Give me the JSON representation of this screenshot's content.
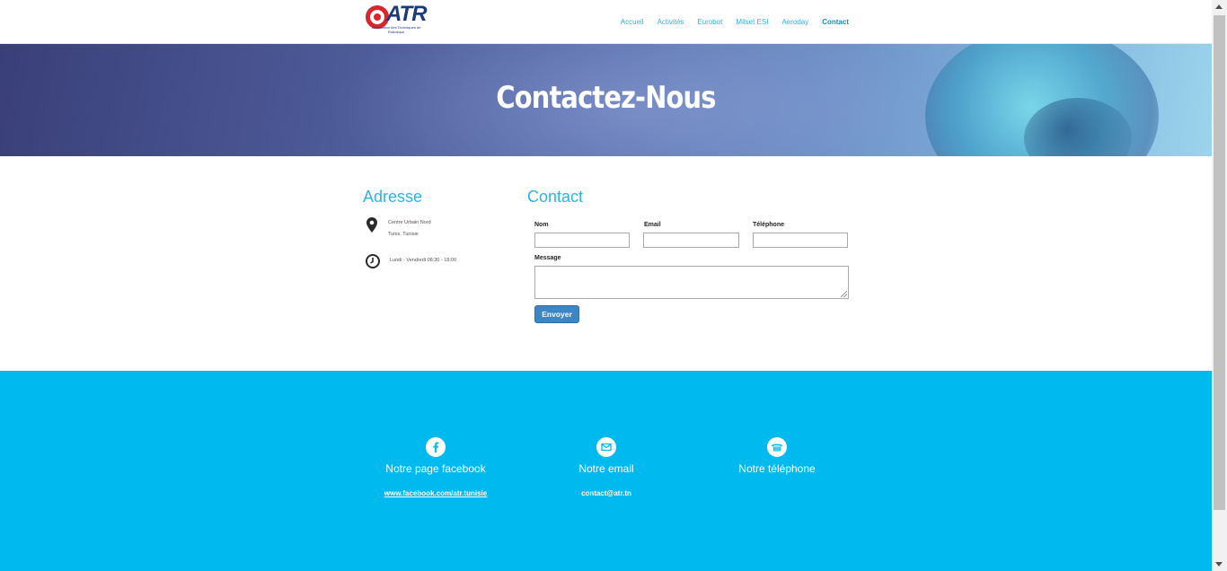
{
  "header": {
    "logo_text": "ATR",
    "logo_tagline": "Association des Techniques de Robotique",
    "nav": [
      {
        "label": "Accueil",
        "active": false
      },
      {
        "label": "Activités",
        "active": false
      },
      {
        "label": "Eurobot",
        "active": false
      },
      {
        "label": "Milset ESI",
        "active": false
      },
      {
        "label": "Aeroday",
        "active": false
      },
      {
        "label": "Contact",
        "active": true
      }
    ]
  },
  "banner": {
    "title": "Contactez-Nous"
  },
  "address": {
    "title": "Adresse",
    "location_line1": "Centre Urbain Nord",
    "location_line2": "Tunis, Tunisie",
    "hours": "Lundi - Vendredi 08:30 - 18:00",
    "icons": {
      "location": "map-marker-icon",
      "hours": "clock-icon"
    }
  },
  "contact_form": {
    "title": "Contact",
    "fields": {
      "nom": {
        "label": "Nom",
        "value": ""
      },
      "email": {
        "label": "Email",
        "value": ""
      },
      "telephone": {
        "label": "Téléphone",
        "value": ""
      },
      "message": {
        "label": "Message",
        "value": ""
      }
    },
    "submit_label": "Envoyer"
  },
  "footer": {
    "facebook": {
      "icon": "facebook-icon",
      "title": "Notre page facebook",
      "link": "www.facebook.com/atr.tunisie"
    },
    "email": {
      "icon": "envelope-icon",
      "title": "Notre email",
      "value": "contact@atr.tn"
    },
    "phone": {
      "icon": "phone-icon",
      "title": "Notre téléphone"
    }
  },
  "colors": {
    "accent": "#2cb4e0",
    "footer_bg": "#00b9ee",
    "button": "#3c86c6",
    "logo_red": "#d9262c",
    "logo_blue": "#1d3a7a"
  }
}
